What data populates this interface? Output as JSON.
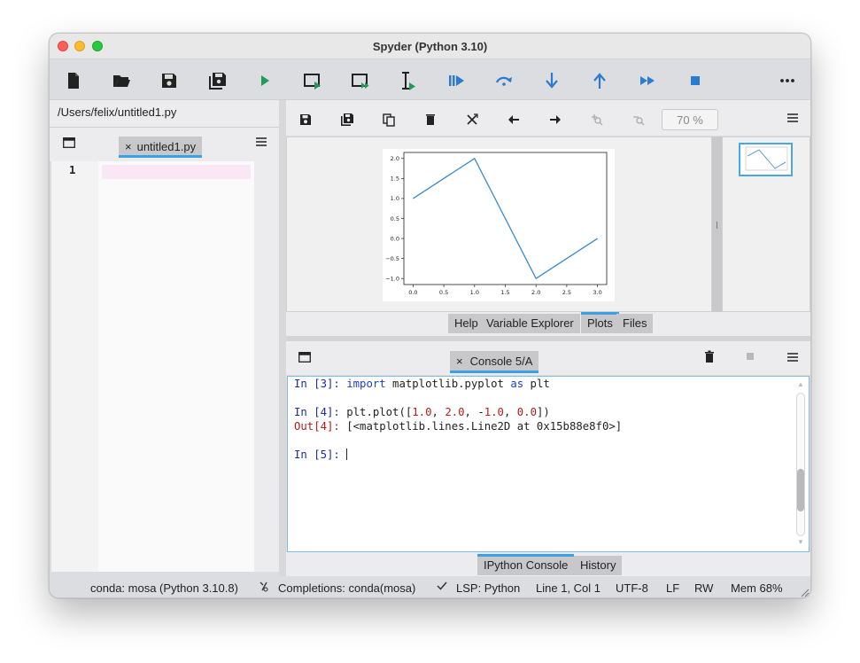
{
  "window": {
    "title": "Spyder (Python 3.10)"
  },
  "toolbar": {
    "buttons": [
      "new-file",
      "open-file",
      "save-file",
      "save-all",
      "run-file",
      "run-cell",
      "run-cell-advance",
      "run-selection",
      "debug-file",
      "debug-step",
      "debug-step-into",
      "debug-step-return",
      "debug-continue",
      "debug-stop",
      "more-options"
    ]
  },
  "editor": {
    "path": "/Users/felix/untitled1.py",
    "tab_label": "untitled1.py",
    "tab_close": "×",
    "line_number": "1"
  },
  "plots_pane": {
    "zoom_value": "70 %",
    "tabs": [
      "Help",
      "Variable Explorer",
      "Plots",
      "Files"
    ],
    "active_tab": "Plots"
  },
  "chart_data": {
    "type": "line",
    "x": [
      0.0,
      1.0,
      2.0,
      3.0
    ],
    "y": [
      1.0,
      2.0,
      -1.0,
      0.0
    ],
    "xticks": [
      "0.0",
      "0.5",
      "1.0",
      "1.5",
      "2.0",
      "2.5",
      "3.0"
    ],
    "yticks": [
      "2.0",
      "1.5",
      "1.0",
      "0.5",
      "0.0",
      "−0.5",
      "−1.0"
    ],
    "xlim": [
      -0.15,
      3.15
    ],
    "ylim": [
      -1.15,
      2.15
    ],
    "color": "#3d8ac7"
  },
  "console": {
    "tab_label": "Console 5/A",
    "tab_close": "×",
    "lines": [
      {
        "prompt": "In [3]:",
        "kind": "in",
        "parts": [
          {
            "t": "import",
            "c": "kw"
          },
          {
            "t": " matplotlib.pyplot ",
            "c": ""
          },
          {
            "t": "as",
            "c": "kw"
          },
          {
            "t": " plt",
            "c": ""
          }
        ]
      },
      {
        "prompt": "",
        "kind": "blank",
        "parts": []
      },
      {
        "prompt": "In [4]:",
        "kind": "in",
        "parts": [
          {
            "t": "plt.plot([",
            "c": ""
          },
          {
            "t": "1.0",
            "c": "num"
          },
          {
            "t": ", ",
            "c": ""
          },
          {
            "t": "2.0",
            "c": "num"
          },
          {
            "t": ", -",
            "c": ""
          },
          {
            "t": "1.0",
            "c": "num"
          },
          {
            "t": ", ",
            "c": ""
          },
          {
            "t": "0.0",
            "c": "num"
          },
          {
            "t": "])",
            "c": ""
          }
        ]
      },
      {
        "prompt": "Out[4]:",
        "kind": "out",
        "parts": [
          {
            "t": "[<matplotlib.lines.Line2D at 0x15b88e8f0>]",
            "c": ""
          }
        ]
      },
      {
        "prompt": "",
        "kind": "blank",
        "parts": []
      },
      {
        "prompt": "In [5]:",
        "kind": "in",
        "parts": [
          {
            "t": "",
            "c": ""
          }
        ]
      }
    ],
    "bottom_tabs": [
      "IPython Console",
      "History"
    ],
    "active_bottom_tab": "IPython Console"
  },
  "status": {
    "conda": "conda: mosa (Python 3.10.8)",
    "completions": "Completions: conda(mosa)",
    "lsp": "LSP: Python",
    "position": "Line 1, Col 1",
    "encoding": "UTF-8",
    "eol": "LF",
    "mode": "RW",
    "mem": "Mem 68%"
  },
  "colors": {
    "accent": "#3aa0e8",
    "icon_blue": "#2b7bd0",
    "icon_green": "#1f9a57"
  }
}
